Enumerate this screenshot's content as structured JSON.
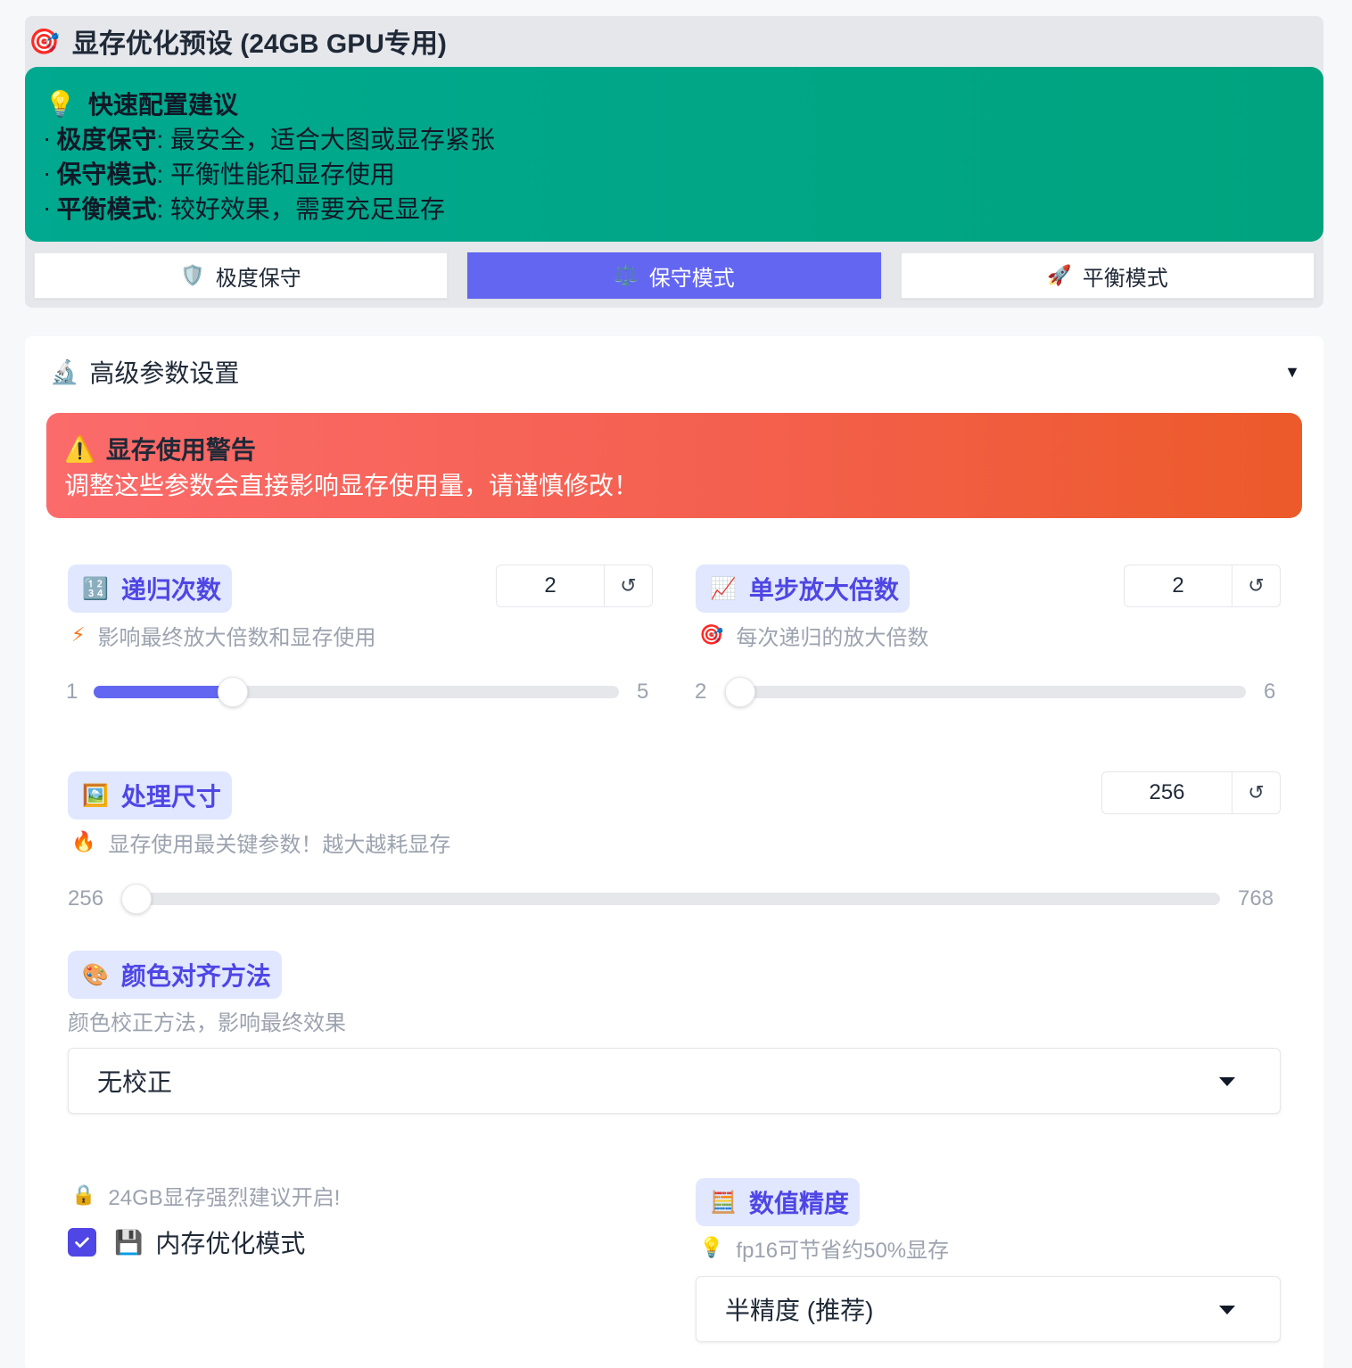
{
  "preset": {
    "icon": "target-icon",
    "title": "显存优化预设 (24GB GPU专用)",
    "tips": {
      "icon": "lightbulb-icon",
      "heading": "快速配置建议",
      "items": [
        {
          "name": "极度保守",
          "desc": ": 最安全，适合大图或显存紧张"
        },
        {
          "name": "保守模式",
          "desc": ": 平衡性能和显存使用"
        },
        {
          "name": "平衡模式",
          "desc": ": 较好效果，需要充足显存"
        }
      ]
    },
    "buttons": [
      {
        "icon": "shield-icon",
        "label": "极度保守",
        "active": false
      },
      {
        "icon": "scales-icon",
        "label": "保守模式",
        "active": true
      },
      {
        "icon": "rocket-icon",
        "label": "平衡模式",
        "active": false
      }
    ],
    "accent": "#6366f1"
  },
  "advanced": {
    "icon": "microscope-icon",
    "title": "高级参数设置",
    "warning": {
      "icon": "warning-icon",
      "heading": "显存使用警告",
      "body": "调整这些参数会直接影响显存使用量，请谨慎修改！"
    },
    "recursion": {
      "icon": "numbers-icon",
      "label": "递归次数",
      "desc_icon": "lightning-icon",
      "desc": "影响最终放大倍数和显存使用",
      "value": "2",
      "min": "1",
      "max": "5",
      "fraction": 0.25
    },
    "scale": {
      "icon": "chart-up-icon",
      "label": "单步放大倍数",
      "desc_icon": "target-icon",
      "desc": "每次递归的放大倍数",
      "value": "2",
      "min": "2",
      "max": "6",
      "fraction": 0
    },
    "size": {
      "icon": "picture-icon",
      "label": "处理尺寸",
      "desc_icon": "fire-icon",
      "desc": "显存使用最关键参数！越大越耗显存",
      "value": "256",
      "min": "256",
      "max": "768",
      "fraction": 0
    },
    "color": {
      "icon": "palette-icon",
      "label": "颜色对齐方法",
      "desc": "颜色校正方法，影响最终效果",
      "selected": "无校正"
    },
    "memory": {
      "hint_icon": "lock-icon",
      "hint": "24GB显存强烈建议开启!",
      "checked": true,
      "icon": "floppy-icon",
      "label": "内存优化模式"
    },
    "precision": {
      "icon": "abacus-icon",
      "label": "数值精度",
      "desc_icon": "lightbulb-icon",
      "desc": "fp16可节省约50%显存",
      "selected": "半精度 (推荐)"
    }
  }
}
